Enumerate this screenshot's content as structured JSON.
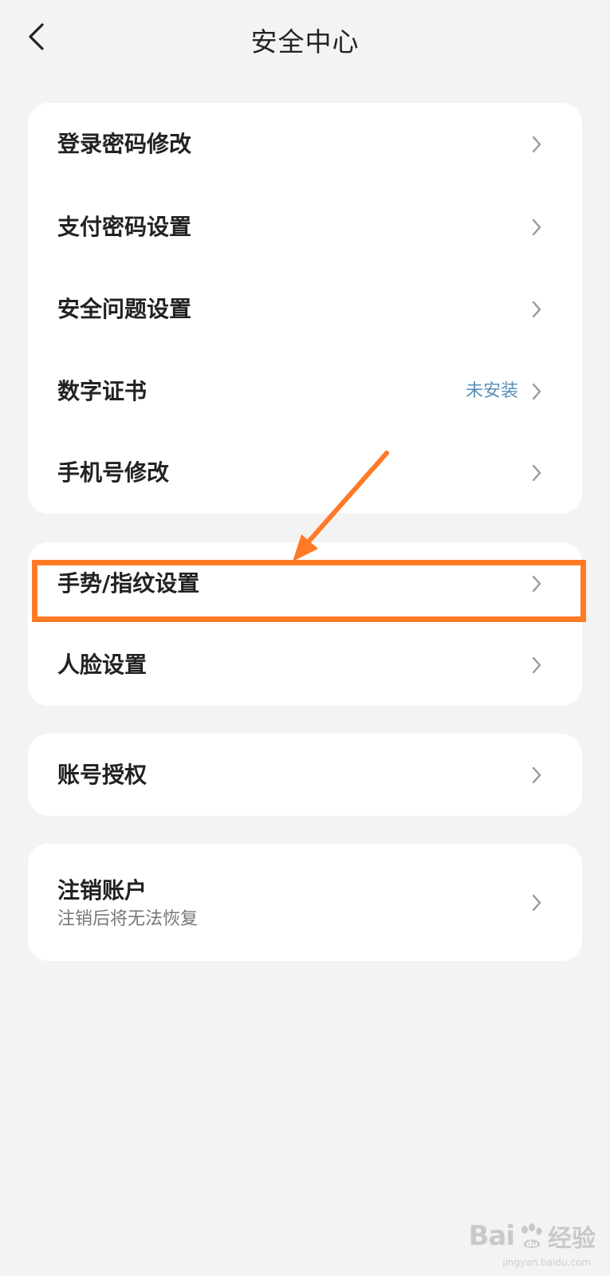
{
  "header": {
    "title": "安全中心",
    "back_icon": "chevron-left-icon"
  },
  "groups": [
    {
      "items": [
        {
          "label": "登录密码修改"
        },
        {
          "label": "支付密码设置"
        },
        {
          "label": "安全问题设置"
        },
        {
          "label": "数字证书",
          "value": "未安装"
        },
        {
          "label": "手机号修改"
        }
      ]
    },
    {
      "items": [
        {
          "label": "手势/指纹设置"
        },
        {
          "label": "人脸设置"
        }
      ]
    },
    {
      "items": [
        {
          "label": "账号授权"
        }
      ]
    },
    {
      "items": [
        {
          "label": "注销账户",
          "sublabel": "注销后将无法恢复"
        }
      ]
    }
  ],
  "annotation": {
    "color": "#ff7a26",
    "highlighted_item": "手势/指纹设置"
  },
  "watermark": {
    "brand": "Bai",
    "brand_suffix": "经验",
    "url": "jingyan.baidu.com"
  },
  "colors": {
    "background": "#f3f3f3",
    "card": "#ffffff",
    "value_text": "#5a8fb8",
    "chevron": "#9a9a9a"
  }
}
